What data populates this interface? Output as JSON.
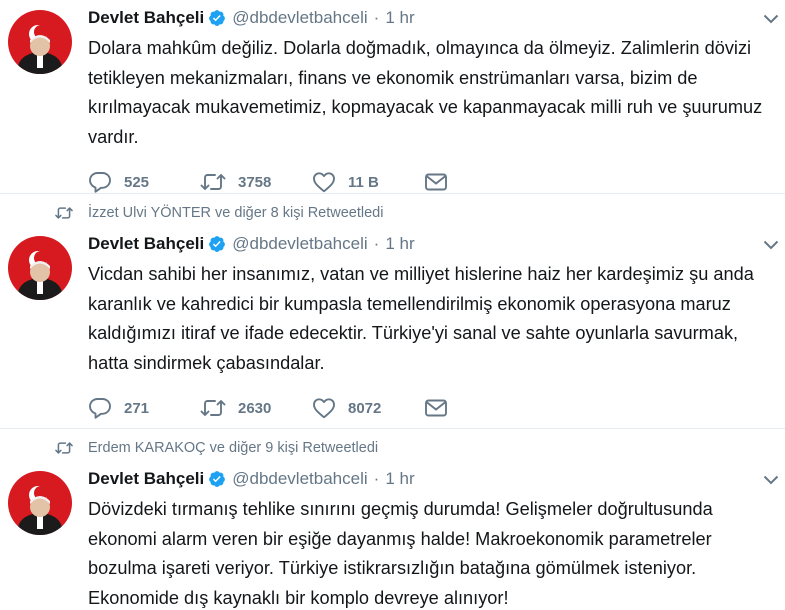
{
  "tweets": [
    {
      "retweeted_by": "",
      "name": "Devlet Bahçeli",
      "handle": "@dbdevletbahceli",
      "separator": "·",
      "time": "1 hr",
      "text": "Dolara mahkûm değiliz. Dolarla doğmadık, olmayınca da ölmeyiz. Zalimlerin dövizi tetikleyen mekanizmaları, finans ve ekonomik enstrümanları varsa, bizim de kırılmayacak mukavemetimiz, kopmayacak ve kapanmayacak milli ruh ve şuurumuz vardır.",
      "replies": "525",
      "retweets": "3758",
      "likes": "11 B"
    },
    {
      "retweeted_by": "İzzet Ulvi YÖNTER ve diğer 8 kişi Retweetledi",
      "name": "Devlet Bahçeli",
      "handle": "@dbdevletbahceli",
      "separator": "·",
      "time": "1 hr",
      "text": "Vicdan sahibi her insanımız, vatan ve milliyet hislerine haiz her kardeşimiz şu anda karanlık ve kahredici bir kumpasla temellendirilmiş ekonomik operasyona maruz kaldığımızı itiraf ve ifade edecektir. Türkiye'yi sanal ve sahte oyunlarla savurmak, hatta sindirmek çabasındalar.",
      "replies": "271",
      "retweets": "2630",
      "likes": "8072"
    },
    {
      "retweeted_by": "Erdem KARAKOÇ ve diğer 9 kişi Retweetledi",
      "name": "Devlet Bahçeli",
      "handle": "@dbdevletbahceli",
      "separator": "·",
      "time": "1 hr",
      "text": "Dövizdeki tırmanış tehlike sınırını geçmiş durumda! Gelişmeler doğrultusunda ekonomi alarm veren bir eşiğe dayanmış halde! Makroekonomik parametreler bozulma işareti veriyor. Türkiye istikrarsızlığın batağına gömülmek isteniyor. Ekonomide dış kaynaklı bir komplo devreye alınıyor!",
      "replies": "",
      "retweets": "",
      "likes": ""
    }
  ],
  "colors": {
    "verified": "#1da1f2",
    "muted": "#657786",
    "text": "#14171a",
    "avatar_red": "#d71920"
  },
  "icons": [
    "verified-badge-icon",
    "chevron-down-icon",
    "reply-icon",
    "retweet-icon",
    "like-icon",
    "message-icon"
  ]
}
